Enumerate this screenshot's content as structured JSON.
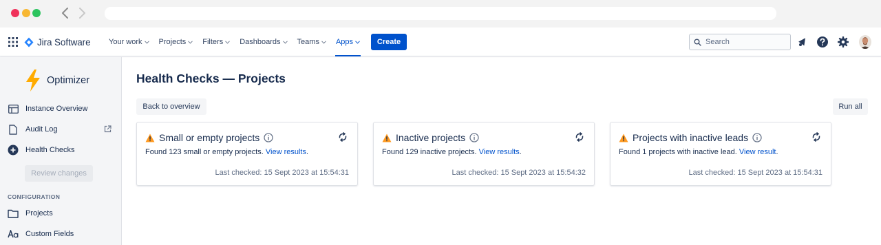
{
  "colors": {
    "brand_blue": "#0052cc",
    "warning_orange": "#ff991f",
    "optimizer_yellow": "#ffab00",
    "sidebar_bg": "#f4f5f7"
  },
  "topnav": {
    "product_name": "Jira Software",
    "menu": [
      {
        "label": "Your work",
        "active": false
      },
      {
        "label": "Projects",
        "active": false
      },
      {
        "label": "Filters",
        "active": false
      },
      {
        "label": "Dashboards",
        "active": false
      },
      {
        "label": "Teams",
        "active": false
      },
      {
        "label": "Apps",
        "active": true
      }
    ],
    "create_label": "Create",
    "search_placeholder": "Search",
    "icons": [
      "apps-grid-icon",
      "notifications-icon",
      "help-icon",
      "settings-icon"
    ]
  },
  "sidebar": {
    "app_name": "Optimizer",
    "items": [
      {
        "label": "Instance Overview",
        "icon": "table-icon"
      },
      {
        "label": "Audit Log",
        "icon": "document-icon",
        "external": true
      },
      {
        "label": "Health Checks",
        "icon": "plus-circle-icon"
      }
    ],
    "review_label": "Review changes",
    "section_label": "CONFIGURATION",
    "config_items": [
      {
        "label": "Projects",
        "icon": "folder-icon"
      },
      {
        "label": "Custom Fields",
        "icon": "text-format-icon"
      }
    ]
  },
  "main": {
    "title": "Health Checks — Projects",
    "back_label": "Back to overview",
    "run_all_label": "Run all",
    "cards": [
      {
        "title": "Small or empty projects",
        "body": "Found 123 small or empty projects.",
        "link": "View results",
        "after_link": ".",
        "last_checked": "Last checked: 15 Sept 2023 at 15:54:31"
      },
      {
        "title": "Inactive projects",
        "body": "Found 129 inactive projects.",
        "link": "View results",
        "after_link": ".",
        "last_checked": "Last checked: 15 Sept 2023 at 15:54:32"
      },
      {
        "title": "Projects with inactive leads",
        "body": "Found 1 projects with inactive lead.",
        "link": "View result",
        "after_link": ".",
        "last_checked": "Last checked: 15 Sept 2023 at 15:54:31"
      }
    ]
  }
}
